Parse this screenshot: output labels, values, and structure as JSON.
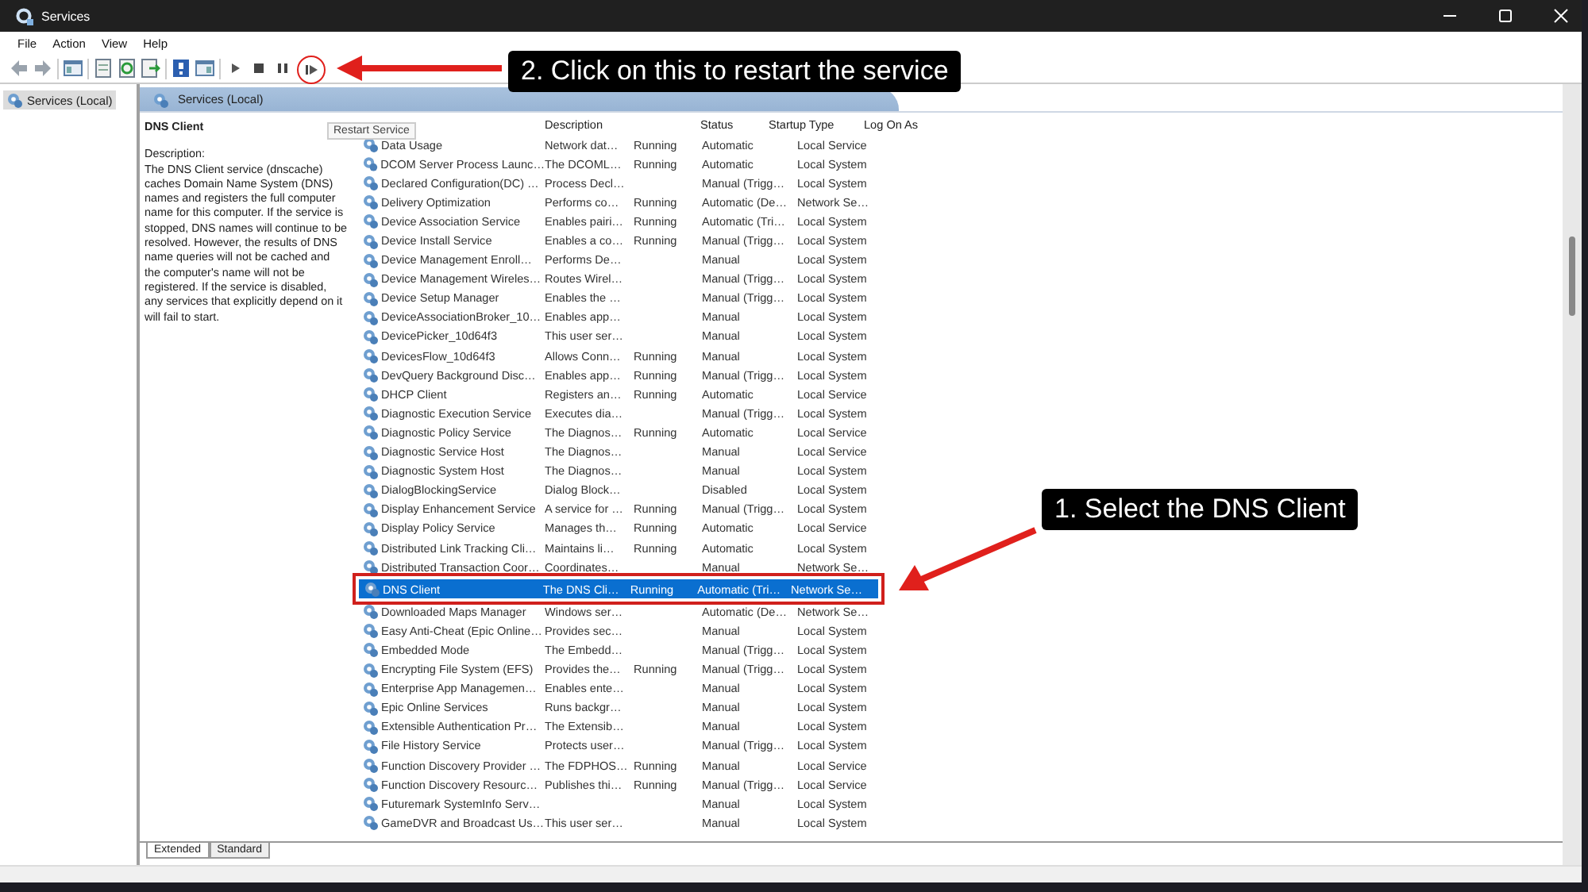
{
  "window": {
    "title": "Services"
  },
  "menu": [
    "File",
    "Action",
    "View",
    "Help"
  ],
  "tree": {
    "items": [
      {
        "label": "Services (Local)",
        "selected": true
      }
    ]
  },
  "header": {
    "title": "Services (Local)"
  },
  "details": {
    "title": "DNS Client",
    "label": "Description:",
    "text": "The DNS Client service (dnscache) caches Domain Name System (DNS) names and registers the full computer name for this computer. If the service is stopped, DNS names will continue to be resolved. However, the results of DNS name queries will not be cached and the computer's name will not be registered. If the service is disabled, any services that explicitly depend on it will fail to start."
  },
  "tooltip": "Restart Service",
  "table": {
    "columns": [
      "Description",
      "Status",
      "Startup Type",
      "Log On As"
    ],
    "rows": [
      {
        "name": "Data Usage",
        "description": "Network dat…",
        "status": "Running",
        "startup": "Automatic",
        "logon": "Local Service",
        "selected": false
      },
      {
        "name": "DCOM Server Process Launc…",
        "description": "The DCOML…",
        "status": "Running",
        "startup": "Automatic",
        "logon": "Local System",
        "selected": false
      },
      {
        "name": "Declared Configuration(DC) …",
        "description": "Process Decl…",
        "status": "",
        "startup": "Manual (Trigg…",
        "logon": "Local System",
        "selected": false
      },
      {
        "name": "Delivery Optimization",
        "description": "Performs co…",
        "status": "Running",
        "startup": "Automatic (De…",
        "logon": "Network Se…",
        "selected": false
      },
      {
        "name": "Device Association Service",
        "description": "Enables pairi…",
        "status": "Running",
        "startup": "Automatic (Tri…",
        "logon": "Local System",
        "selected": false
      },
      {
        "name": "Device Install Service",
        "description": "Enables a co…",
        "status": "Running",
        "startup": "Manual (Trigg…",
        "logon": "Local System",
        "selected": false
      },
      {
        "name": "Device Management Enroll…",
        "description": "Performs De…",
        "status": "",
        "startup": "Manual",
        "logon": "Local System",
        "selected": false
      },
      {
        "name": "Device Management Wireles…",
        "description": "Routes Wirel…",
        "status": "",
        "startup": "Manual (Trigg…",
        "logon": "Local System",
        "selected": false
      },
      {
        "name": "Device Setup Manager",
        "description": "Enables the …",
        "status": "",
        "startup": "Manual (Trigg…",
        "logon": "Local System",
        "selected": false
      },
      {
        "name": "DeviceAssociationBroker_10…",
        "description": "Enables app…",
        "status": "",
        "startup": "Manual",
        "logon": "Local System",
        "selected": false
      },
      {
        "name": "DevicePicker_10d64f3",
        "description": "This user ser…",
        "status": "",
        "startup": "Manual",
        "logon": "Local System",
        "selected": false
      },
      {
        "name": "DevicesFlow_10d64f3",
        "description": "Allows Conn…",
        "status": "Running",
        "startup": "Manual",
        "logon": "Local System",
        "selected": false
      },
      {
        "name": "DevQuery Background Disc…",
        "description": "Enables app…",
        "status": "Running",
        "startup": "Manual (Trigg…",
        "logon": "Local System",
        "selected": false
      },
      {
        "name": "DHCP Client",
        "description": "Registers an…",
        "status": "Running",
        "startup": "Automatic",
        "logon": "Local Service",
        "selected": false
      },
      {
        "name": "Diagnostic Execution Service",
        "description": "Executes dia…",
        "status": "",
        "startup": "Manual (Trigg…",
        "logon": "Local System",
        "selected": false
      },
      {
        "name": "Diagnostic Policy Service",
        "description": "The Diagnos…",
        "status": "Running",
        "startup": "Automatic",
        "logon": "Local Service",
        "selected": false
      },
      {
        "name": "Diagnostic Service Host",
        "description": "The Diagnos…",
        "status": "",
        "startup": "Manual",
        "logon": "Local Service",
        "selected": false
      },
      {
        "name": "Diagnostic System Host",
        "description": "The Diagnos…",
        "status": "",
        "startup": "Manual",
        "logon": "Local System",
        "selected": false
      },
      {
        "name": "DialogBlockingService",
        "description": "Dialog Block…",
        "status": "",
        "startup": "Disabled",
        "logon": "Local System",
        "selected": false
      },
      {
        "name": "Display Enhancement Service",
        "description": "A service for …",
        "status": "Running",
        "startup": "Manual (Trigg…",
        "logon": "Local System",
        "selected": false
      },
      {
        "name": "Display Policy Service",
        "description": "Manages th…",
        "status": "Running",
        "startup": "Automatic",
        "logon": "Local Service",
        "selected": false
      },
      {
        "name": "Distributed Link Tracking Cli…",
        "description": "Maintains li…",
        "status": "Running",
        "startup": "Automatic",
        "logon": "Local System",
        "selected": false
      },
      {
        "name": "Distributed Transaction Coor…",
        "description": "Coordinates…",
        "status": "",
        "startup": "Manual",
        "logon": "Network Se…",
        "selected": false
      },
      {
        "name": "DNS Client",
        "description": "The DNS Cli…",
        "status": "Running",
        "startup": "Automatic (Tri…",
        "logon": "Network Se…",
        "selected": true
      },
      {
        "name": "Downloaded Maps Manager",
        "description": "Windows ser…",
        "status": "",
        "startup": "Automatic (De…",
        "logon": "Network Se…",
        "selected": false
      },
      {
        "name": "Easy Anti-Cheat (Epic Online…",
        "description": "Provides sec…",
        "status": "",
        "startup": "Manual",
        "logon": "Local System",
        "selected": false
      },
      {
        "name": "Embedded Mode",
        "description": "The Embedd…",
        "status": "",
        "startup": "Manual (Trigg…",
        "logon": "Local System",
        "selected": false
      },
      {
        "name": "Encrypting File System (EFS)",
        "description": "Provides the…",
        "status": "Running",
        "startup": "Manual (Trigg…",
        "logon": "Local System",
        "selected": false
      },
      {
        "name": "Enterprise App Managemen…",
        "description": "Enables ente…",
        "status": "",
        "startup": "Manual",
        "logon": "Local System",
        "selected": false
      },
      {
        "name": "Epic Online Services",
        "description": "Runs backgr…",
        "status": "",
        "startup": "Manual",
        "logon": "Local System",
        "selected": false
      },
      {
        "name": "Extensible Authentication Pr…",
        "description": "The Extensib…",
        "status": "",
        "startup": "Manual",
        "logon": "Local System",
        "selected": false
      },
      {
        "name": "File History Service",
        "description": "Protects user…",
        "status": "",
        "startup": "Manual (Trigg…",
        "logon": "Local System",
        "selected": false
      },
      {
        "name": "Function Discovery Provider …",
        "description": "The FDPHOS…",
        "status": "Running",
        "startup": "Manual",
        "logon": "Local Service",
        "selected": false
      },
      {
        "name": "Function Discovery Resourc…",
        "description": "Publishes thi…",
        "status": "Running",
        "startup": "Manual (Trigg…",
        "logon": "Local Service",
        "selected": false
      },
      {
        "name": "Futuremark SystemInfo Serv…",
        "description": "",
        "status": "",
        "startup": "Manual",
        "logon": "Local System",
        "selected": false
      },
      {
        "name": "GameDVR and Broadcast Us…",
        "description": "This user ser…",
        "status": "",
        "startup": "Manual",
        "logon": "Local System",
        "selected": false
      }
    ]
  },
  "tabs": [
    {
      "label": "Extended",
      "selected": true
    },
    {
      "label": "Standard",
      "selected": false
    }
  ],
  "annotations": [
    {
      "kind": "toolbar",
      "text": "2. Click on this to restart the service"
    },
    {
      "kind": "row",
      "text": "1. Select the DNS Client"
    }
  ]
}
